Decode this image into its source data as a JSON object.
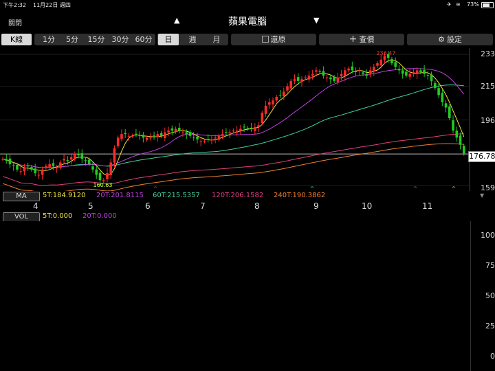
{
  "status": {
    "time": "下午2:32",
    "date": "11月22日 週四",
    "battery": "73%"
  },
  "title": {
    "close": "關閉",
    "name": "蘋果電腦",
    "up_glyph": "▲",
    "down_glyph": "▼"
  },
  "toolbar": {
    "kline": "K線",
    "intervals": [
      "1分",
      "5分",
      "15分",
      "30分",
      "60分"
    ],
    "periods": [
      "日",
      "週",
      "月"
    ],
    "restore": "還原",
    "query": "查價",
    "settings": "設定"
  },
  "price_axis": [
    "233",
    "215",
    "196",
    "176.78",
    "159"
  ],
  "x_labels": [
    "4",
    "5",
    "6",
    "7",
    "8",
    "9",
    "10",
    "11"
  ],
  "annotations": {
    "high": "233.47",
    "low": "160.63"
  },
  "ma": {
    "label": "MA",
    "values": [
      {
        "text": "5T:184.9120",
        "color": "#f0e040"
      },
      {
        "text": "20T:201.8115",
        "color": "#c040e0"
      },
      {
        "text": "60T:215.5357",
        "color": "#40d0a0"
      },
      {
        "text": "120T:206.1582",
        "color": "#e04080"
      },
      {
        "text": "240T:190.3862",
        "color": "#f08030"
      }
    ]
  },
  "vol": {
    "label": "VOL",
    "values": [
      {
        "text": "5T:0.000",
        "color": "#f0e040"
      },
      {
        "text": "20T:0.000",
        "color": "#c040e0"
      }
    ]
  },
  "vol_axis": [
    "100",
    "75",
    "50",
    "25",
    "0"
  ],
  "chart_data": {
    "type": "candlestick",
    "last_price": 176.78,
    "high": 233.47,
    "low": 160.63,
    "ylim": [
      159,
      235
    ],
    "months": [
      "4",
      "5",
      "6",
      "7",
      "8",
      "9",
      "10",
      "11"
    ],
    "closes": [
      174,
      173,
      171,
      170,
      168,
      167,
      169,
      170,
      168,
      166,
      165,
      168,
      170,
      171,
      170,
      169,
      172,
      174,
      173,
      175,
      177,
      176,
      174,
      173,
      171,
      168,
      165,
      162,
      162,
      166,
      172,
      180,
      186,
      188,
      188,
      187,
      187,
      188,
      187,
      186,
      186,
      186,
      187,
      188,
      187,
      189,
      190,
      190,
      191,
      190,
      189,
      188,
      187,
      186,
      185,
      184,
      184,
      185,
      185,
      186,
      187,
      188,
      189,
      189,
      190,
      190,
      191,
      192,
      191,
      191,
      192,
      193,
      200,
      204,
      206,
      207,
      209,
      210,
      212,
      215,
      218,
      219,
      218,
      219,
      220,
      221,
      222,
      224,
      223,
      221,
      220,
      219,
      218,
      220,
      222,
      224,
      225,
      224,
      223,
      224,
      222,
      221,
      224,
      226,
      228,
      230,
      232,
      231,
      228,
      226,
      224,
      222,
      221,
      222,
      223,
      224,
      223,
      222,
      221,
      218,
      214,
      210,
      206,
      203,
      197,
      190,
      186,
      182,
      177
    ]
  }
}
